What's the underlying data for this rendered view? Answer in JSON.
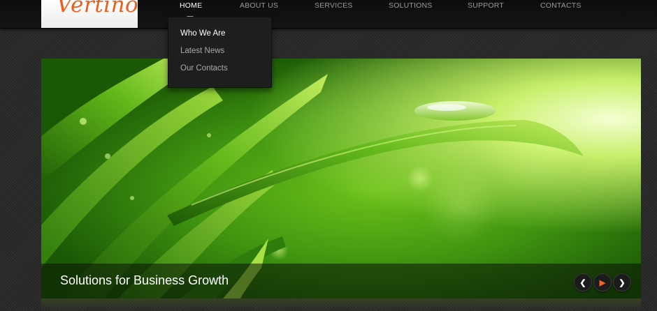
{
  "logo": {
    "text": "Vertino"
  },
  "nav": {
    "items": [
      {
        "label": "HOME",
        "active": true
      },
      {
        "label": "ABOUT US"
      },
      {
        "label": "SERVICES"
      },
      {
        "label": "SOLUTIONS"
      },
      {
        "label": "SUPPORT"
      },
      {
        "label": "CONTACTS"
      }
    ],
    "dropdown": [
      {
        "label": "Who We Are",
        "active": true
      },
      {
        "label": "Latest News"
      },
      {
        "label": "Our Contacts"
      }
    ]
  },
  "slider": {
    "caption": "Solutions for Business Growth",
    "controls": {
      "prev_icon": "chevron-left-icon",
      "play_icon": "play-icon",
      "next_icon": "chevron-right-icon"
    },
    "colors": {
      "accent": "#8cc63f",
      "play": "#f26522",
      "logo": "#e8601c"
    }
  }
}
